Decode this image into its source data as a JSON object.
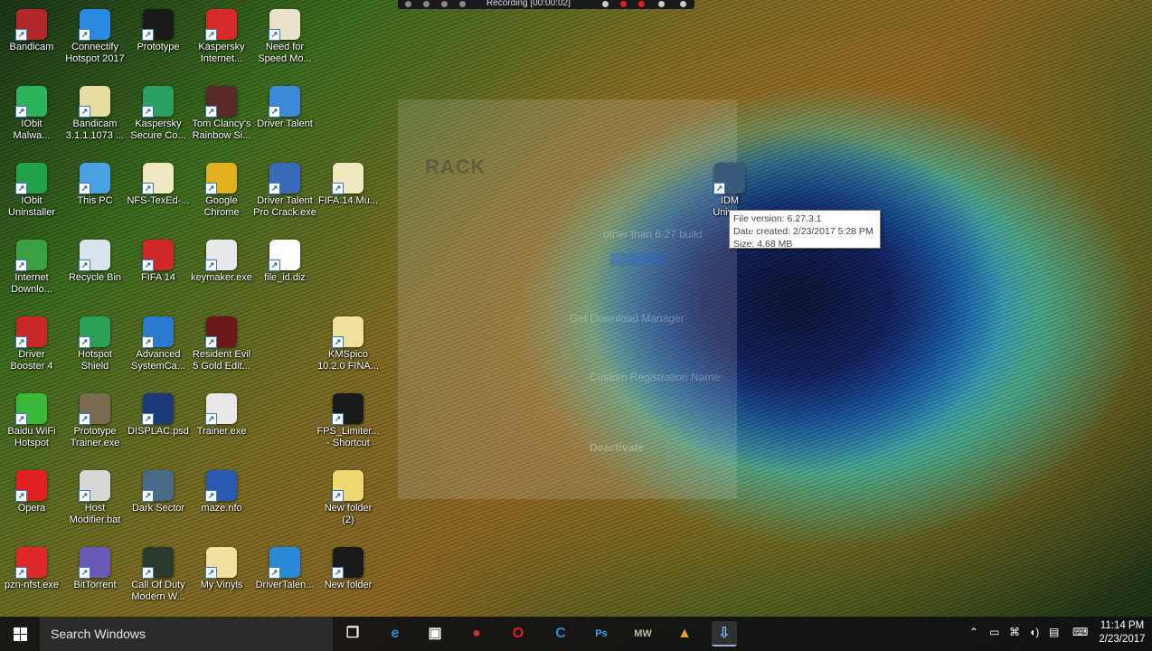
{
  "recording_bar": {
    "text": "Recording [00:00:02]"
  },
  "desktop_icons": [
    {
      "label": "Bandicam",
      "color": "#b0282a"
    },
    {
      "label": "Connectify\nHotspot 2017",
      "color": "#2a8ae0"
    },
    {
      "label": "Prototype",
      "color": "#1a1a1a"
    },
    {
      "label": "Kaspersky\nInternet...",
      "color": "#d42a2a"
    },
    {
      "label": "Need for\nSpeed Mo...",
      "color": "#e8e2c8"
    },
    {
      "label": "IObit\nMalwa...",
      "color": "#2db35a"
    },
    {
      "label": "Bandicam\n3.1.1.1073 ...",
      "color": "#e8dca0"
    },
    {
      "label": "Kaspersky\nSecure Co...",
      "color": "#2aa060"
    },
    {
      "label": "Tom Clancy's\nRainbow Si...",
      "color": "#5a2a2a"
    },
    {
      "label": "Driver Talent",
      "color": "#3a8ad8"
    },
    {
      "label": "IObit\nUninstaller",
      "color": "#22a34a"
    },
    {
      "label": "This PC",
      "color": "#4aa0e0"
    },
    {
      "label": "NFS-TexEd-...",
      "color": "#f0e8c0"
    },
    {
      "label": "Google\nChrome",
      "color": "#e0b020"
    },
    {
      "label": "Driver Talent\nPro Crack.exe",
      "color": "#3a6ab8"
    },
    {
      "label": "FIFA.14.Mu...",
      "color": "#f0e8c0"
    },
    {
      "label": "Internet\nDownlo...",
      "color": "#3aa040"
    },
    {
      "label": "Recycle Bin",
      "color": "#d8e4ec"
    },
    {
      "label": "FIFA 14",
      "color": "#d02828"
    },
    {
      "label": "keymaker.exe",
      "color": "#e8e8e8"
    },
    {
      "label": "file_id.diz",
      "color": "#ffffff"
    },
    {
      "label": "Driver\nBooster 4",
      "color": "#c82828"
    },
    {
      "label": "Hotspot\nShield",
      "color": "#2aa058"
    },
    {
      "label": "Advanced\nSystemCa...",
      "color": "#2a7ad0"
    },
    {
      "label": "Resident Evil\n5 Gold Edit...",
      "color": "#6a1a1a"
    },
    {
      "label": "KMSpico\n10.2.0 FINA...",
      "color": "#f0e0a0"
    },
    {
      "label": "Baidu WiFi\nHotspot",
      "color": "#3ab83a"
    },
    {
      "label": "Prototype\nTrainer.exe",
      "color": "#7a6a50"
    },
    {
      "label": "DISPLAC.psd",
      "color": "#1a3a7a"
    },
    {
      "label": "Trainer.exe",
      "color": "#e8e8e8"
    },
    {
      "label": "FPS_Limiter...\n- Shortcut",
      "color": "#1a1a1a"
    },
    {
      "label": "Opera",
      "color": "#e02020"
    },
    {
      "label": "Host\nModifier.bat",
      "color": "#d8d8d8"
    },
    {
      "label": "Dark Sector",
      "color": "#4a6a8a"
    },
    {
      "label": "maze.nfo",
      "color": "#2a5ab0"
    },
    {
      "label": "New folder\n(2)",
      "color": "#f0d870"
    },
    {
      "label": "pzn-nfst.exe",
      "color": "#e02828"
    },
    {
      "label": "BitTorrent",
      "color": "#6a5ab8"
    },
    {
      "label": "Call Of Duty\nModern W...",
      "color": "#2a3a2a"
    },
    {
      "label": "My Vinyls",
      "color": "#f0e0a0"
    },
    {
      "label": "DriverTalen...",
      "color": "#2a8ad8"
    },
    {
      "label": "New folder",
      "color": "#1a1a1a"
    },
    {
      "label": "IDM\nUnive...",
      "color": "#3a5a7a"
    }
  ],
  "faded_window": {
    "logo": "RACK",
    "line1": "other than 6.27 build",
    "line2": "Get Download Manager",
    "line3": "Custom Registration Name",
    "line4": "Deactivate"
  },
  "tooltip": {
    "line1": "File version: 6.27.3.1",
    "line2": "Date created: 2/23/2017 5:28 PM",
    "line3": "Size: 4.68 MB"
  },
  "taskbar": {
    "search_placeholder": "Search Windows",
    "apps": [
      {
        "name": "task-view",
        "glyph": "❐",
        "color": "#ffffff"
      },
      {
        "name": "edge",
        "glyph": "e",
        "color": "#1e8ae6"
      },
      {
        "name": "store",
        "glyph": "▣",
        "color": "#ffffff"
      },
      {
        "name": "bandicam",
        "glyph": "●",
        "color": "#d02a2a"
      },
      {
        "name": "opera",
        "glyph": "O",
        "color": "#e02020"
      },
      {
        "name": "advanced-systemcare",
        "glyph": "C",
        "color": "#2a8ae0"
      },
      {
        "name": "photoshop",
        "glyph": "Ps",
        "color": "#31a8ff"
      },
      {
        "name": "call-of-duty",
        "glyph": "MW",
        "color": "#b8c0a8"
      },
      {
        "name": "need-for-speed",
        "glyph": "▲",
        "color": "#e0a020"
      },
      {
        "name": "idm",
        "glyph": "⇩",
        "color": "#6ab0e8"
      }
    ],
    "clock_time": "11:14 PM",
    "clock_date": "2/23/2017"
  }
}
